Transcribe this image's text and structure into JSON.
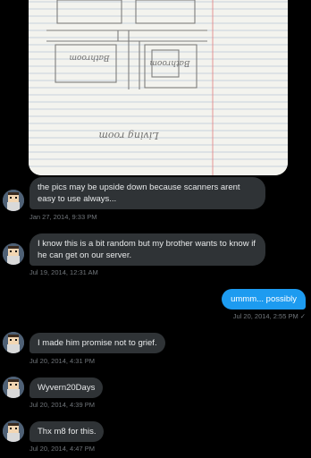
{
  "conversation": {
    "messages": [
      {
        "direction": "in",
        "text": "the pics may be upside down because scanners arent easy to use always...",
        "timestamp": "Jan 27, 2014, 9:33 PM"
      },
      {
        "direction": "in",
        "text": "I know this is a bit random but my brother wants to know if he can get on our server.",
        "timestamp": "Jul 19, 2014, 12:31 AM"
      },
      {
        "direction": "out",
        "text": "ummm... possibly",
        "timestamp": "Jul 20, 2014, 2:55 PM"
      },
      {
        "direction": "in",
        "text": "I made him promise not to grief.",
        "timestamp": "Jul 20, 2014, 4:31 PM"
      },
      {
        "direction": "in",
        "text": "Wyvern20Days",
        "timestamp": "Jul 20, 2014, 4:39 PM"
      },
      {
        "direction": "in",
        "text": "Thx m8 for this.",
        "timestamp": "Jul 20, 2014, 4:47 PM"
      }
    ],
    "read_check": "✓"
  },
  "attachment": {
    "handwritten_labels": [
      "Bathroom",
      "Bathroom",
      "Living room"
    ]
  },
  "colors": {
    "incoming_bubble": "#2f3336",
    "outgoing_bubble": "#1d9bf0",
    "timestamp": "#71767b",
    "background": "#000000"
  },
  "icons": {
    "avatar": "user-avatar-icon",
    "read": "checkmark-icon"
  }
}
